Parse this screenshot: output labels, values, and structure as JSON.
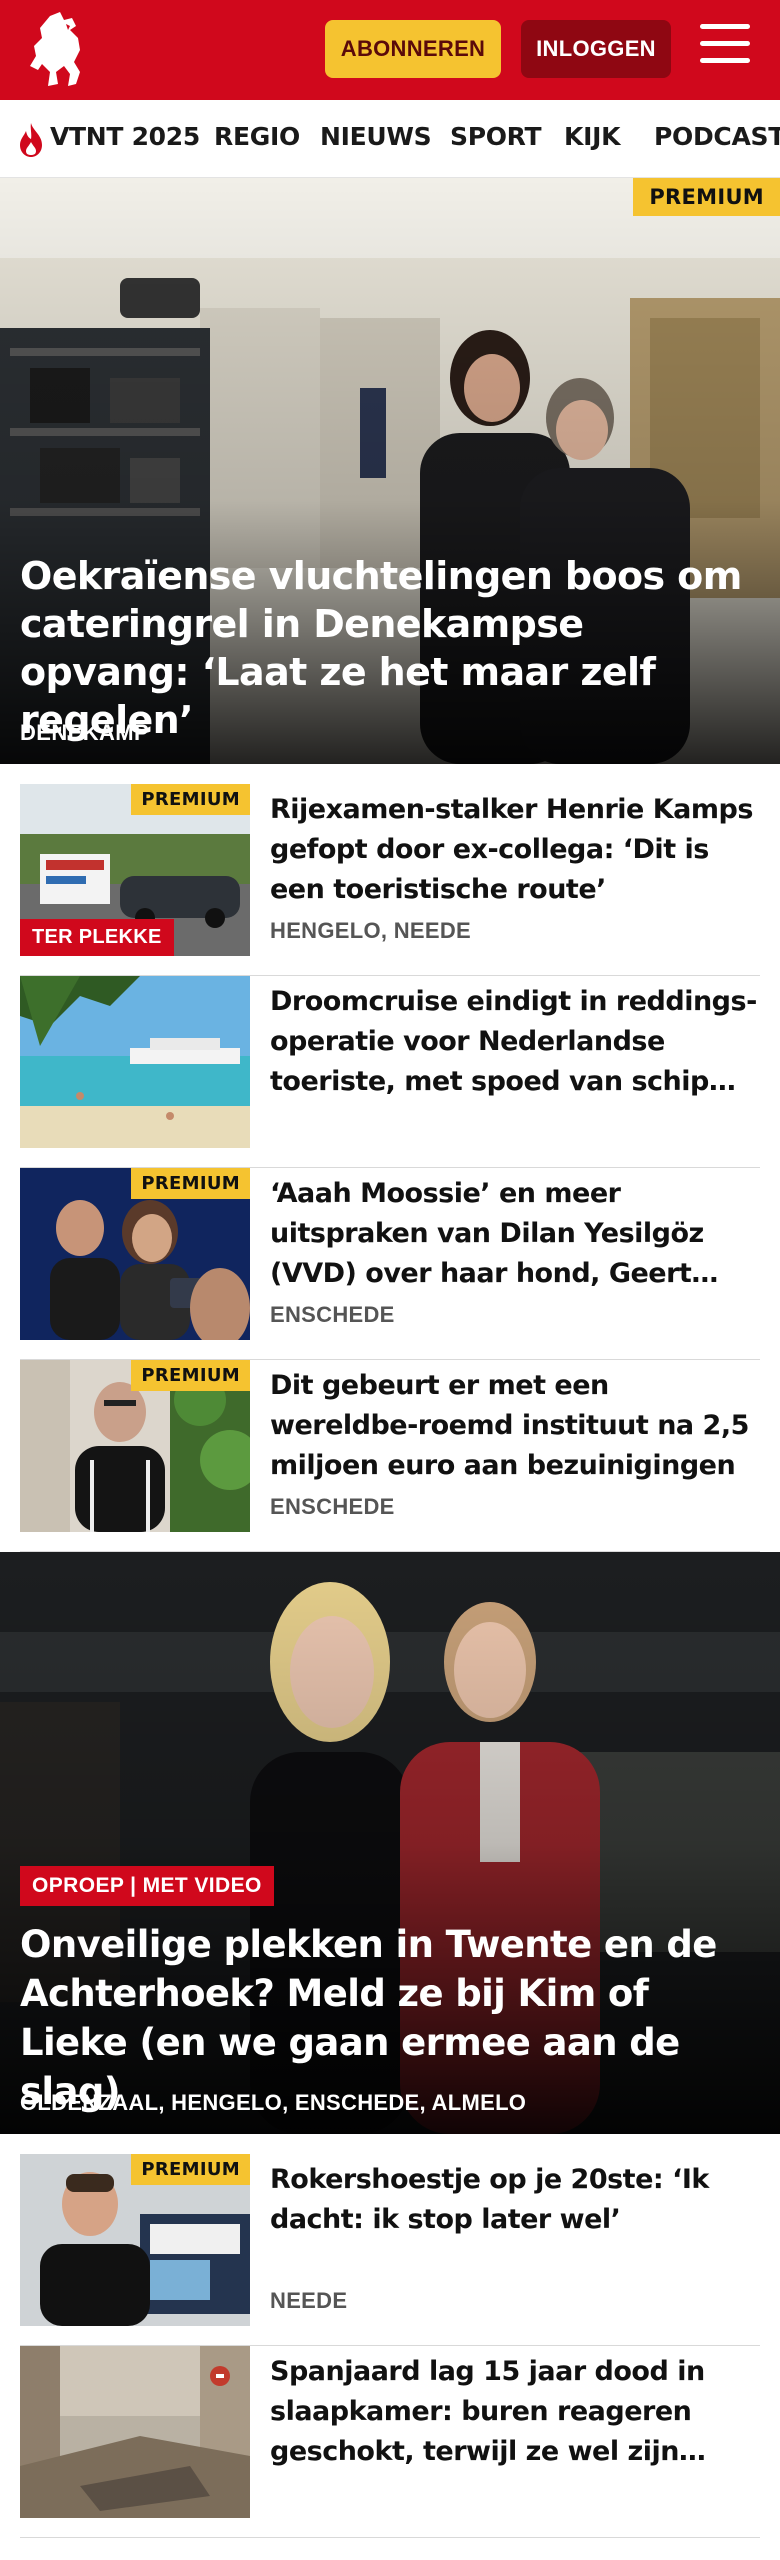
{
  "header": {
    "logo_icon": "horse-logo-icon",
    "subscribe_label": "ABONNEREN",
    "login_label": "INLOGGEN",
    "menu_icon": "hamburger-menu-icon",
    "brand_color": "#d0081c",
    "subscribe_color": "#f5c330"
  },
  "nav": {
    "items": [
      {
        "label": "VTNT 2025",
        "icon": "flame-icon"
      },
      {
        "label": "REGIO"
      },
      {
        "label": "NIEUWS"
      },
      {
        "label": "SPORT"
      },
      {
        "label": "KIJK"
      },
      {
        "label": "PODCAST"
      }
    ]
  },
  "hero": {
    "badge": "PREMIUM",
    "title": "Oekraïense vluchtelingen boos om cateringrel in Denekampse opvang: ‘Laat ze het maar zelf regelen’",
    "location": "DENEKAMP"
  },
  "articles_top": [
    {
      "badge": "PREMIUM",
      "tag": "TER PLEKKE",
      "title": "Rijexamen-stalker Henrie Kamps gefopt door ex-collega: ‘Dit is een toeristische route’",
      "location": "HENGELO, NEEDE"
    },
    {
      "title": "Droomcruise eindigt in reddings-operatie voor Nederlandse toeriste, met spoed van schip…",
      "location": ""
    },
    {
      "badge": "PREMIUM",
      "title": "‘Aaah Moossie’ en meer uitspraken van Dilan Yesilgöz (VVD) over haar hond, Geert…",
      "location": "ENSCHEDE"
    },
    {
      "badge": "PREMIUM",
      "title": "Dit gebeurt er met een wereldbe-roemd instituut na 2,5 miljoen euro aan bezuinigingen",
      "location": "ENSCHEDE"
    }
  ],
  "feature": {
    "badge": "OPROEP | MET VIDEO",
    "title": "Onveilige plekken in Twente en de Achterhoek? Meld ze bij Kim of Lieke (en we gaan ermee aan de slag)",
    "location": "OLDENZAAL, HENGELO, ENSCHEDE, ALMELO"
  },
  "articles_bottom": [
    {
      "badge": "PREMIUM",
      "title": "Rokershoestje op je 20ste: ‘Ik dacht: ik stop later wel’",
      "location": "NEEDE"
    },
    {
      "title": "Spanjaard lag 15 jaar dood in slaapkamer: buren reageren geschokt, terwijl ze wel zijn…",
      "location": ""
    }
  ]
}
